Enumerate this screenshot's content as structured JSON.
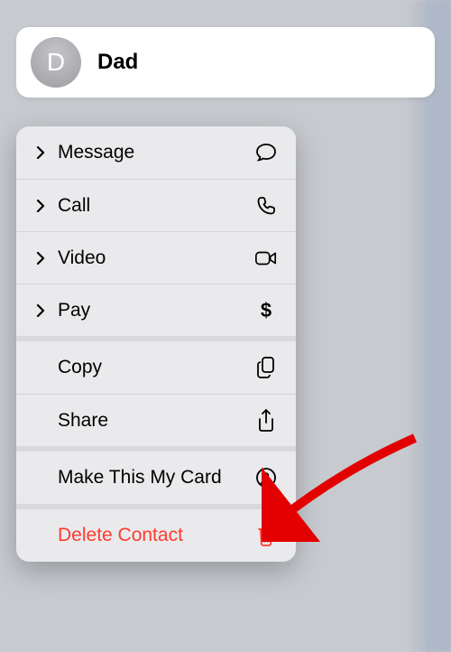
{
  "contact": {
    "avatar_letter": "D",
    "name": "Dad"
  },
  "menu": {
    "group1": {
      "message": "Message",
      "call": "Call",
      "video": "Video",
      "pay": "Pay"
    },
    "group2": {
      "copy": "Copy",
      "share": "Share"
    },
    "group3": {
      "make_card": "Make This My Card"
    },
    "group4": {
      "delete": "Delete Contact"
    }
  },
  "colors": {
    "danger": "#ff3b30",
    "menu_bg": "#eaeaec",
    "card_bg": "#ffffff"
  }
}
